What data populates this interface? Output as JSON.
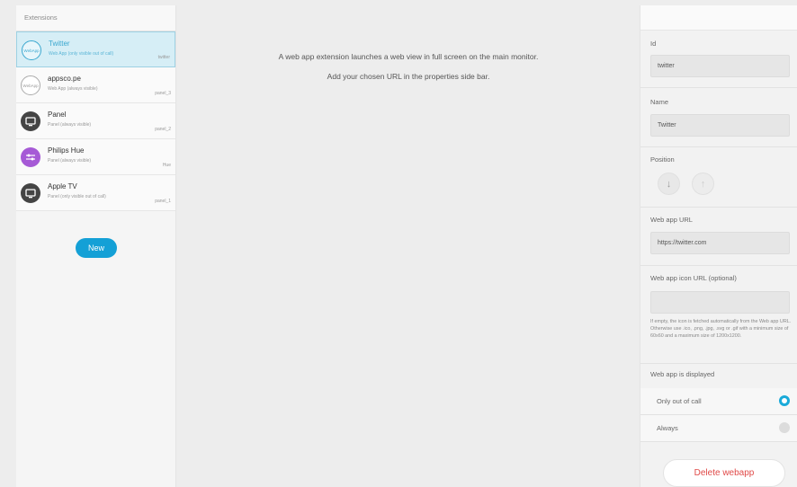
{
  "sidebar": {
    "header": "Extensions",
    "new_button": "New",
    "items": [
      {
        "name": "Twitter",
        "sub": "Web App (only visible out of call)",
        "tag": "twitter",
        "icon": "webapp-icon",
        "icon_text": "WebApp",
        "selected": true
      },
      {
        "name": "appsco.pe",
        "sub": "Web App (always visible)",
        "tag": "panel_3",
        "icon": "webapp-icon",
        "icon_text": "WebApp",
        "selected": false
      },
      {
        "name": "Panel",
        "sub": "Panel (always visible)",
        "tag": "panel_2",
        "icon": "monitor-icon",
        "selected": false
      },
      {
        "name": "Philips Hue",
        "sub": "Panel (always visible)",
        "tag": "Hue",
        "icon": "sliders-icon",
        "selected": false
      },
      {
        "name": "Apple TV",
        "sub": "Panel (only visible out of call)",
        "tag": "panel_1",
        "icon": "monitor-icon",
        "selected": false
      }
    ]
  },
  "main": {
    "line1": "A web app extension launches a web view in full screen on the main monitor.",
    "line2": "Add your chosen URL in the properties side bar."
  },
  "props": {
    "id_label": "Id",
    "id_value": "twitter",
    "name_label": "Name",
    "name_value": "Twitter",
    "position_label": "Position",
    "url_label": "Web app URL",
    "url_value": "https://twitter.com",
    "icon_url_label": "Web app icon URL (optional)",
    "icon_url_value": "",
    "help_text": "If empty, the icon is fetched automatically from the Web app URL. Otherwise use .ico, .png, .jpg, .svg or .gif with a minimum size of 60x60 and a maximum size of 1200x1200.",
    "displayed_label": "Web app is displayed",
    "option_out_of_call": "Only out of call",
    "option_always": "Always",
    "delete_button": "Delete webapp"
  },
  "colors": {
    "accent": "#14a0d6",
    "selected_bg": "#d6eef6",
    "delete": "#e04a48",
    "purple_icon": "#a65ad6"
  }
}
